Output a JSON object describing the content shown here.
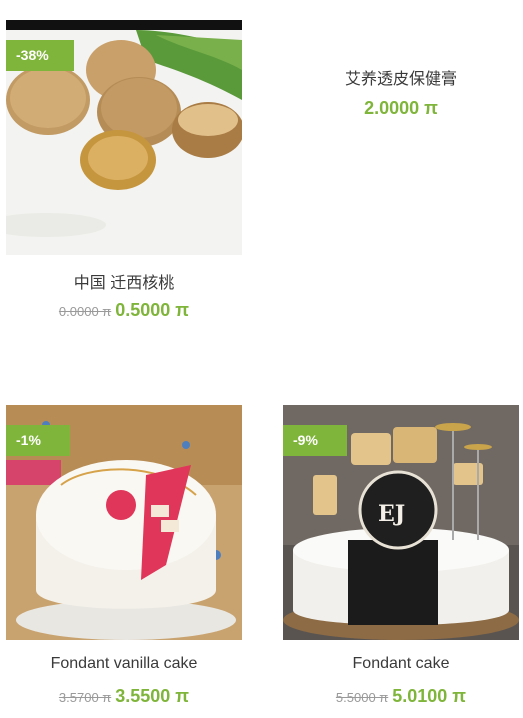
{
  "products": [
    {
      "name": "中国 迁西核桃",
      "badge": "-38%",
      "old_price": "0.0000 π",
      "price": "0.5000 π"
    },
    {
      "name": "艾养透皮保健膏",
      "price": "2.0000 π"
    },
    {
      "name": "Fondant vanilla cake",
      "badge": "-1%",
      "old_price": "3.5700 π",
      "price": "3.5500 π"
    },
    {
      "name": "Fondant cake",
      "badge": "-9%",
      "old_price": "5.5000 π",
      "price": "5.0100 π",
      "cake_initials": "EJ"
    }
  ],
  "colors": {
    "accent": "#7fb53a",
    "old_price": "#9a9a9a"
  }
}
